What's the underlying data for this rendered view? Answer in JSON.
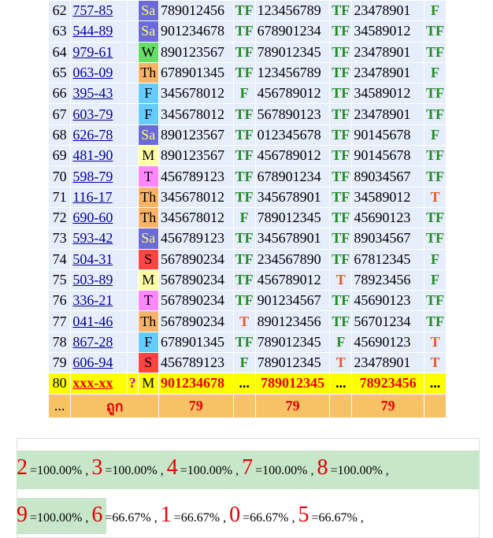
{
  "table": {
    "rows": [
      {
        "idx": "62",
        "code": "757-85",
        "day": "Sa",
        "daycolor": "#6a6ad8",
        "daytext": "#ffff66",
        "n1": "789012456",
        "r1": "TF",
        "n2": "123456789",
        "r2": "TF",
        "n3": "23478901",
        "r3": "F"
      },
      {
        "idx": "63",
        "code": "544-89",
        "day": "Sa",
        "daycolor": "#6a6ad8",
        "daytext": "#ffff66",
        "n1": "901234678",
        "r1": "TF",
        "n2": "678901234",
        "r2": "TF",
        "n3": "34589012",
        "r3": "TF"
      },
      {
        "idx": "64",
        "code": "979-61",
        "day": "W",
        "daycolor": "#66dd66",
        "daytext": "#000000",
        "n1": "890123567",
        "r1": "TF",
        "n2": "789012345",
        "r2": "TF",
        "n3": "23478901",
        "r3": "TF"
      },
      {
        "idx": "65",
        "code": "063-09",
        "day": "Th",
        "daycolor": "#f7b36a",
        "daytext": "#000000",
        "n1": "678901345",
        "r1": "TF",
        "n2": "123456789",
        "r2": "TF",
        "n3": "23478901",
        "r3": "F"
      },
      {
        "idx": "66",
        "code": "395-43",
        "day": "F",
        "daycolor": "#66ccff",
        "daytext": "#000000",
        "n1": "345678012",
        "r1": "F",
        "n2": "456789012",
        "r2": "TF",
        "n3": "34589012",
        "r3": "TF"
      },
      {
        "idx": "67",
        "code": "603-79",
        "day": "F",
        "daycolor": "#66ccff",
        "daytext": "#000000",
        "n1": "345678012",
        "r1": "TF",
        "n2": "567890123",
        "r2": "TF",
        "n3": "23478901",
        "r3": "TF"
      },
      {
        "idx": "68",
        "code": "626-78",
        "day": "Sa",
        "daycolor": "#6a6ad8",
        "daytext": "#ffff66",
        "n1": "890123567",
        "r1": "TF",
        "n2": "012345678",
        "r2": "TF",
        "n3": "90145678",
        "r3": "F"
      },
      {
        "idx": "69",
        "code": "481-90",
        "day": "M",
        "daycolor": "#ffffaa",
        "daytext": "#000000",
        "n1": "890123567",
        "r1": "TF",
        "n2": "456789012",
        "r2": "TF",
        "n3": "90145678",
        "r3": "TF"
      },
      {
        "idx": "70",
        "code": "598-79",
        "day": "T",
        "daycolor": "#ff88ff",
        "daytext": "#000000",
        "n1": "456789123",
        "r1": "TF",
        "n2": "678901234",
        "r2": "TF",
        "n3": "89034567",
        "r3": "TF"
      },
      {
        "idx": "71",
        "code": "116-17",
        "day": "Th",
        "daycolor": "#f7b36a",
        "daytext": "#000000",
        "n1": "345678012",
        "r1": "TF",
        "n2": "345678901",
        "r2": "TF",
        "n3": "34589012",
        "r3": "T"
      },
      {
        "idx": "72",
        "code": "690-60",
        "day": "Th",
        "daycolor": "#f7b36a",
        "daytext": "#000000",
        "n1": "345678012",
        "r1": "F",
        "n2": "789012345",
        "r2": "TF",
        "n3": "45690123",
        "r3": "TF"
      },
      {
        "idx": "73",
        "code": "593-42",
        "day": "Sa",
        "daycolor": "#6a6ad8",
        "daytext": "#ffff66",
        "n1": "456789123",
        "r1": "TF",
        "n2": "345678901",
        "r2": "TF",
        "n3": "89034567",
        "r3": "TF"
      },
      {
        "idx": "74",
        "code": "504-31",
        "day": "S",
        "daycolor": "#ff4444",
        "daytext": "#000000",
        "n1": "567890234",
        "r1": "TF",
        "n2": "234567890",
        "r2": "TF",
        "n3": "67812345",
        "r3": "F"
      },
      {
        "idx": "75",
        "code": "503-89",
        "day": "M",
        "daycolor": "#ffffaa",
        "daytext": "#000000",
        "n1": "567890234",
        "r1": "TF",
        "n2": "456789012",
        "r2": "T",
        "n3": "78923456",
        "r3": "F"
      },
      {
        "idx": "76",
        "code": "336-21",
        "day": "T",
        "daycolor": "#ff88ff",
        "daytext": "#000000",
        "n1": "567890234",
        "r1": "TF",
        "n2": "901234567",
        "r2": "TF",
        "n3": "45690123",
        "r3": "TF"
      },
      {
        "idx": "77",
        "code": "041-46",
        "day": "Th",
        "daycolor": "#f7b36a",
        "daytext": "#000000",
        "n1": "567890234",
        "r1": "T",
        "n2": "890123456",
        "r2": "TF",
        "n3": "56701234",
        "r3": "TF"
      },
      {
        "idx": "78",
        "code": "867-28",
        "day": "F",
        "daycolor": "#66ccff",
        "daytext": "#000000",
        "n1": "678901345",
        "r1": "TF",
        "n2": "789012345",
        "r2": "F",
        "n3": "45690123",
        "r3": "T"
      },
      {
        "idx": "79",
        "code": "606-94",
        "day": "S",
        "daycolor": "#ff4444",
        "daytext": "#000000",
        "n1": "456789123",
        "r1": "F",
        "n2": "789012345",
        "r2": "T",
        "n3": "23478901",
        "r3": "T"
      }
    ],
    "last": {
      "idx": "80",
      "code": "xxx-xx",
      "q": "?",
      "day": "M",
      "n1": "901234678",
      "r1": "...",
      "n2": "789012345",
      "r2": "...",
      "n3": "78923456",
      "r3": "..."
    },
    "summary": {
      "idx": "...",
      "label": "ถูก",
      "c1": "79",
      "c2": "79",
      "c3": "79"
    }
  },
  "stats": {
    "line1": [
      {
        "digit": "2",
        "pct": "=100.00%"
      },
      {
        "digit": "3",
        "pct": "=100.00%"
      },
      {
        "digit": "4",
        "pct": "=100.00%"
      },
      {
        "digit": "7",
        "pct": "=100.00%"
      },
      {
        "digit": "8",
        "pct": "=100.00%"
      }
    ],
    "line2": [
      {
        "digit": "9",
        "pct": "=100.00%"
      },
      {
        "digit": "6",
        "pct": "=66.67%"
      },
      {
        "digit": "1",
        "pct": "=66.67%"
      },
      {
        "digit": "0",
        "pct": "=66.67%"
      },
      {
        "digit": "5",
        "pct": "=66.67%"
      }
    ],
    "separator": " , "
  }
}
